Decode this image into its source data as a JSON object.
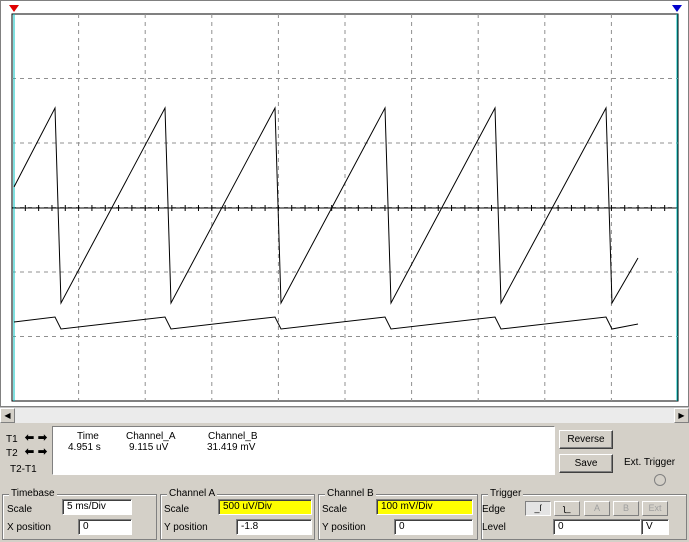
{
  "display": {
    "marker_left_color": "#e00000",
    "marker_right_color": "#0000cc",
    "cursor1_color": "#00c0c0",
    "trace_color": "#000000",
    "grid_color": "#909090"
  },
  "scrollbar": {
    "left_icon": "triangle-left-icon",
    "right_icon": "triangle-right-icon"
  },
  "cursors": {
    "t1_label": "T1",
    "t2_label": "T2",
    "t2_t1_label": "T2-T1",
    "headers": {
      "time": "Time",
      "channel_a": "Channel_A",
      "channel_b": "Channel_B"
    },
    "values": {
      "time": "4.951 s",
      "channel_a": "9.115 uV",
      "channel_b": "31.419 mV"
    }
  },
  "buttons": {
    "reverse": "Reverse",
    "save": "Save",
    "ext_trigger": "Ext. Trigger"
  },
  "timebase": {
    "title": "Timebase",
    "scale_label": "Scale",
    "scale_value": "5 ms/Div",
    "xpos_label": "X position",
    "xpos_value": "0"
  },
  "channel_a": {
    "title": "Channel A",
    "scale_label": "Scale",
    "scale_value": "500 uV/Div",
    "ypos_label": "Y position",
    "ypos_value": "-1.8"
  },
  "channel_b": {
    "title": "Channel B",
    "scale_label": "Scale",
    "scale_value": "100 mV/Div",
    "ypos_label": "Y position",
    "ypos_value": "0"
  },
  "trigger": {
    "title": "Trigger",
    "edge_label": "Edge",
    "level_label": "Level",
    "level_value": "0",
    "level_unit": "V",
    "edge_buttons": [
      "A",
      "B",
      "Ext"
    ]
  }
}
